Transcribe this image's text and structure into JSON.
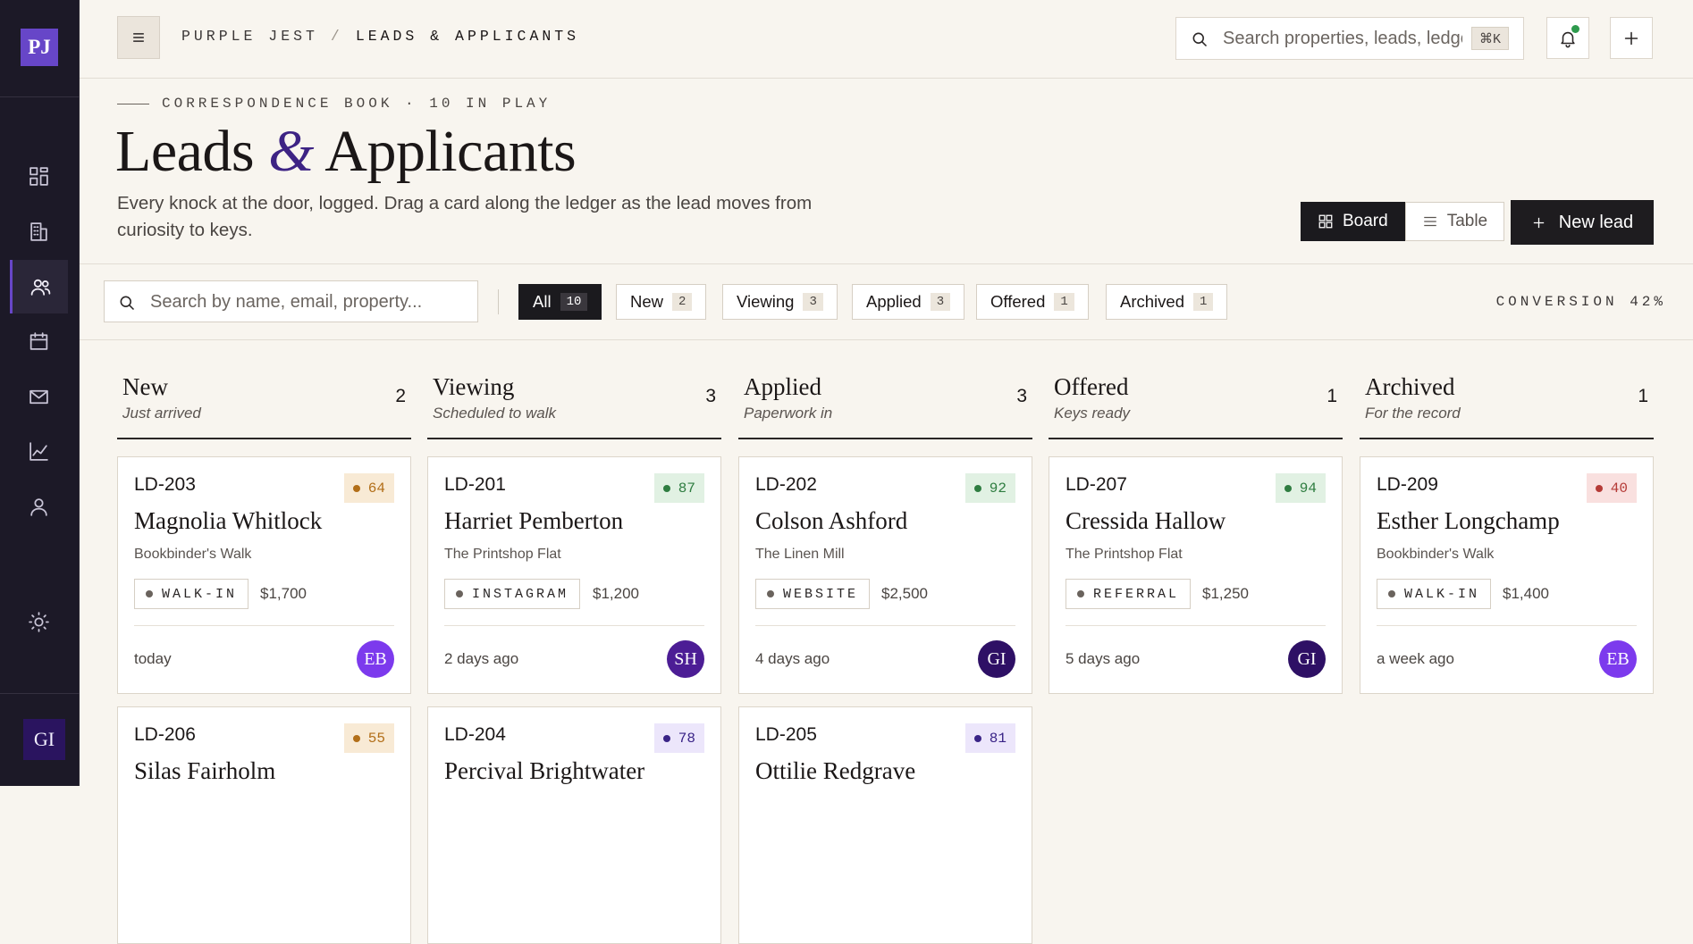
{
  "app": {
    "logo": "PJ",
    "user_initials": "GI"
  },
  "breadcrumb": {
    "org": "PURPLE JEST",
    "sep": "/",
    "page": "LEADS & APPLICANTS"
  },
  "top_search": {
    "placeholder": "Search properties, leads, ledgers",
    "shortcut": "⌘K"
  },
  "header": {
    "eyebrow": "CORRESPONDENCE BOOK · 10 IN PLAY",
    "title_a": "Leads",
    "title_amp": "&",
    "title_b": "Applicants",
    "subtitle": "Every knock at the door, logged. Drag a card along the ledger as the lead moves from curiosity to keys."
  },
  "views": {
    "board": "Board",
    "table": "Table",
    "active": "board"
  },
  "new_lead_label": "New lead",
  "filter": {
    "placeholder": "Search by name, email, property...",
    "chips": [
      {
        "label": "All",
        "count": "10"
      },
      {
        "label": "New",
        "count": "2"
      },
      {
        "label": "Viewing",
        "count": "3"
      },
      {
        "label": "Applied",
        "count": "3"
      },
      {
        "label": "Offered",
        "count": "1"
      },
      {
        "label": "Archived",
        "count": "1"
      }
    ],
    "conversion": "CONVERSION 42%"
  },
  "columns": [
    {
      "title": "New",
      "sub": "Just arrived",
      "count": "2"
    },
    {
      "title": "Viewing",
      "sub": "Scheduled to walk",
      "count": "3"
    },
    {
      "title": "Applied",
      "sub": "Paperwork in",
      "count": "3"
    },
    {
      "title": "Offered",
      "sub": "Keys ready",
      "count": "1"
    },
    {
      "title": "Archived",
      "sub": "For the record",
      "count": "1"
    }
  ],
  "cards": [
    {
      "id": "LD-203",
      "score": "64",
      "name": "Magnolia Whitlock",
      "property": "Bookbinder's Walk",
      "source": "WALK-IN",
      "price": "$1,700",
      "when": "today",
      "initials": "EB"
    },
    {
      "id": "LD-201",
      "score": "87",
      "name": "Harriet Pemberton",
      "property": "The Printshop Flat",
      "source": "INSTAGRAM",
      "price": "$1,200",
      "when": "2 days ago",
      "initials": "SH"
    },
    {
      "id": "LD-202",
      "score": "92",
      "name": "Colson Ashford",
      "property": "The Linen Mill",
      "source": "WEBSITE",
      "price": "$2,500",
      "when": "4 days ago",
      "initials": "GI"
    },
    {
      "id": "LD-207",
      "score": "94",
      "name": "Cressida Hallow",
      "property": "The Printshop Flat",
      "source": "REFERRAL",
      "price": "$1,250",
      "when": "5 days ago",
      "initials": "GI"
    },
    {
      "id": "LD-209",
      "score": "40",
      "name": "Esther Longchamp",
      "property": "Bookbinder's Walk",
      "source": "WALK-IN",
      "price": "$1,400",
      "when": "a week ago",
      "initials": "EB"
    },
    {
      "id": "LD-206",
      "score": "55",
      "name": "Silas Fairholm"
    },
    {
      "id": "LD-204",
      "score": "78",
      "name": "Percival Brightwater"
    },
    {
      "id": "LD-205",
      "score": "81",
      "name": "Ottilie Redgrave"
    }
  ],
  "colors": {
    "accent": "#6746c8",
    "sidebar": "#1c1927",
    "dark_button": "#1e1c1f"
  }
}
